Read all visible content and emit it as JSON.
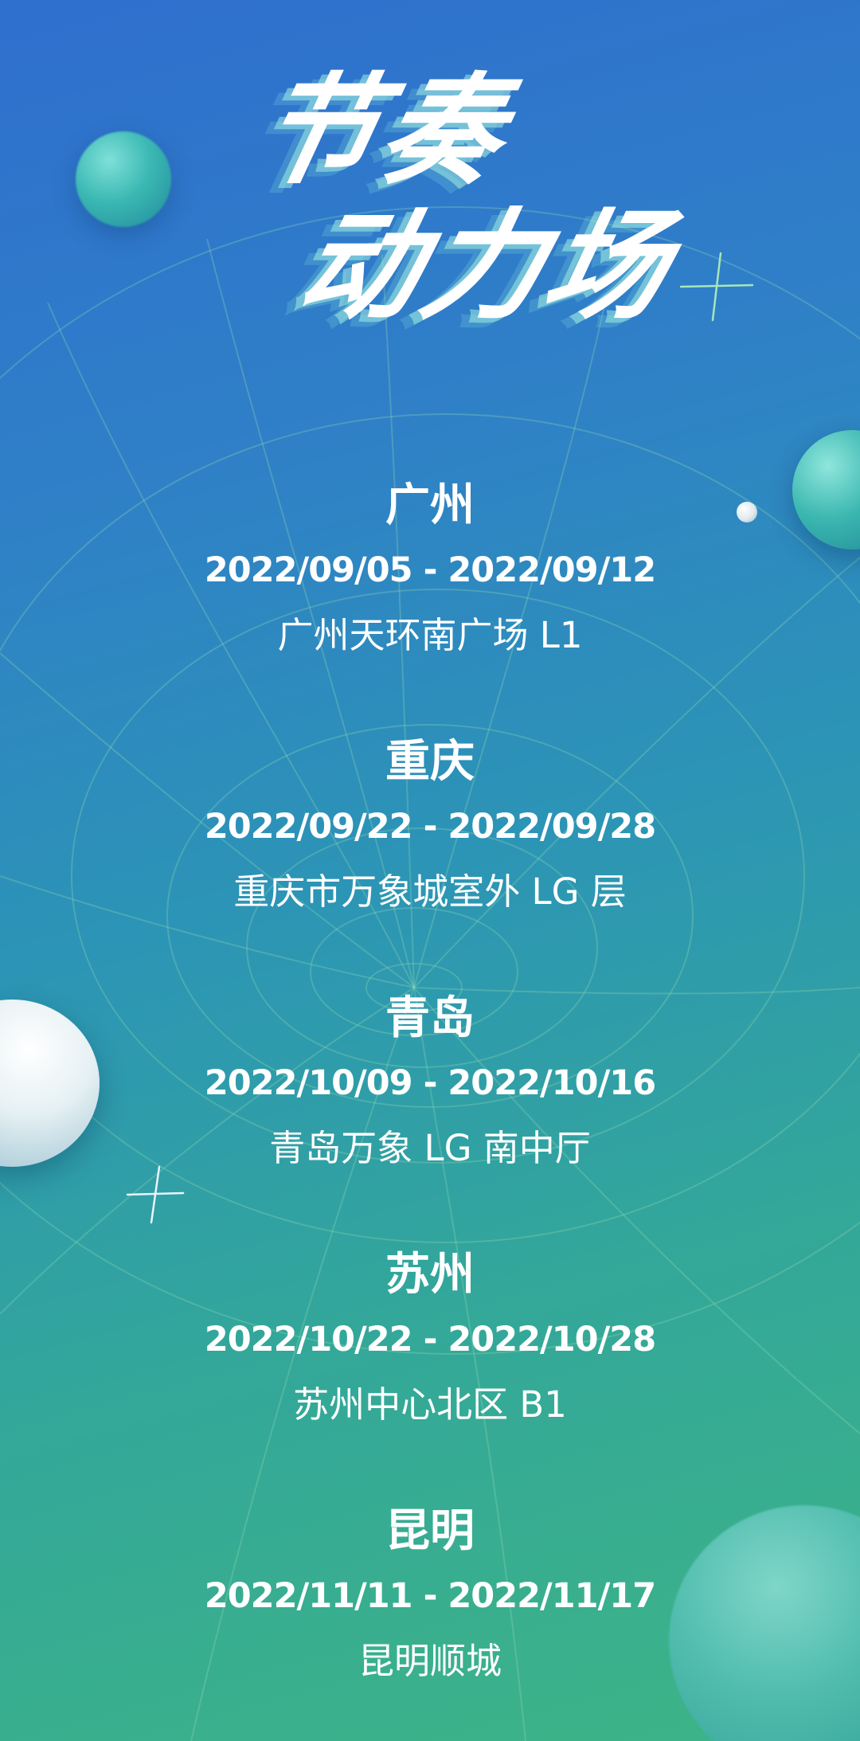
{
  "title": {
    "line1": "节奏",
    "line2": "动力场"
  },
  "events": [
    {
      "city": "广州",
      "dates": "2022/09/05 - 2022/09/12",
      "venue": "广州天环南广场 L1"
    },
    {
      "city": "重庆",
      "dates": "2022/09/22 - 2022/09/28",
      "venue": "重庆市万象城室外 LG 层"
    },
    {
      "city": "青岛",
      "dates": "2022/10/09 - 2022/10/16",
      "venue": "青岛万象 LG 南中厅"
    },
    {
      "city": "苏州",
      "dates": "2022/10/22 - 2022/10/28",
      "venue": "苏州中心北区 B1"
    },
    {
      "city": "昆明",
      "dates": "2022/11/11 - 2022/11/17",
      "venue": "昆明顺城"
    }
  ],
  "colors": {
    "background_top": "#2f6fce",
    "background_bottom": "#3db486",
    "text": "#ffffff",
    "grid_lines": "#8fd3a8"
  },
  "icons": [
    "sphere-decoration",
    "sparkle-icon",
    "wireframe-tunnel-grid"
  ]
}
